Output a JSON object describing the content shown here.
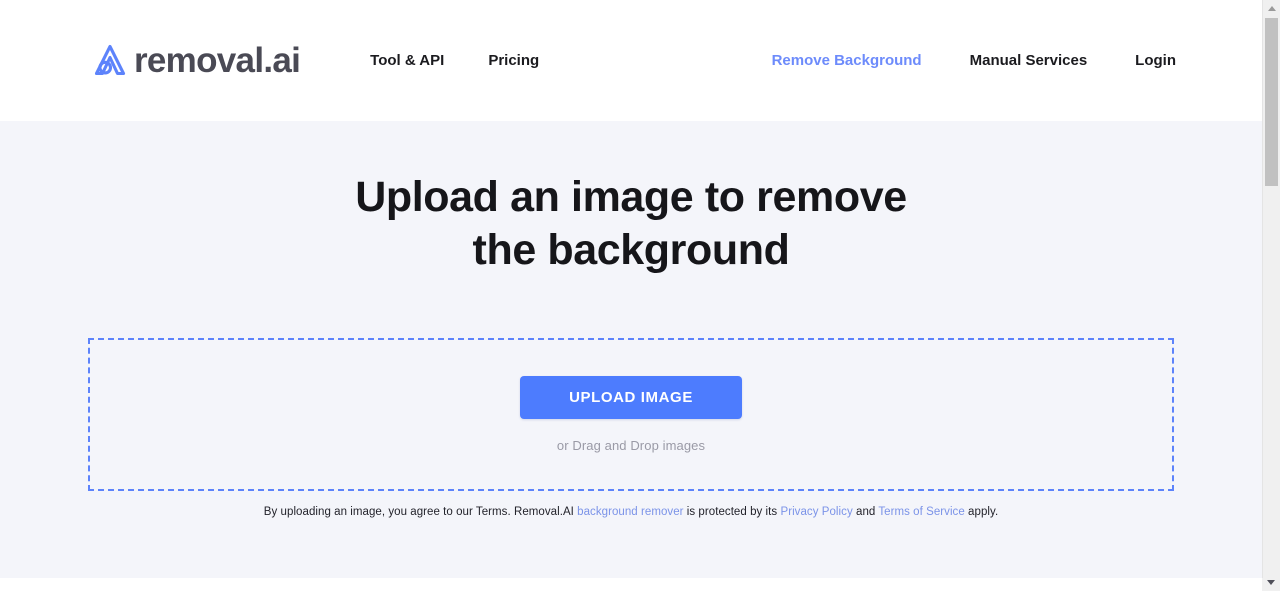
{
  "brand": {
    "name": "removal.ai",
    "logo_color": "#5d83fb",
    "text_color": "#4a4a55"
  },
  "header": {
    "primary_nav": [
      {
        "label": "Tool & API"
      },
      {
        "label": "Pricing"
      }
    ],
    "secondary_nav": [
      {
        "label": "Remove Background",
        "accent": true
      },
      {
        "label": "Manual Services",
        "accent": false
      },
      {
        "label": "Login",
        "accent": false
      }
    ],
    "accent_color": "#6d8bfb"
  },
  "hero": {
    "title_line_1": "Upload an image to remove",
    "title_line_2": "the background"
  },
  "dropzone": {
    "upload_button_label": "UPLOAD IMAGE",
    "drag_hint": "or Drag and Drop images",
    "border_color": "#5d83fb",
    "button_color": "#4d7cfe"
  },
  "legal": {
    "part_1": "By uploading an image, you agree to our Terms. Removal.AI ",
    "link_1": "background remover",
    "part_2": " is protected by its ",
    "link_2": "Privacy Policy",
    "part_3": " and ",
    "link_3": "Terms of Service",
    "part_4": " apply.",
    "link_color": "#7b93e8"
  },
  "scrollbar": {
    "up_arrow": "scroll-up-arrow",
    "down_arrow": "scroll-down-arrow"
  }
}
